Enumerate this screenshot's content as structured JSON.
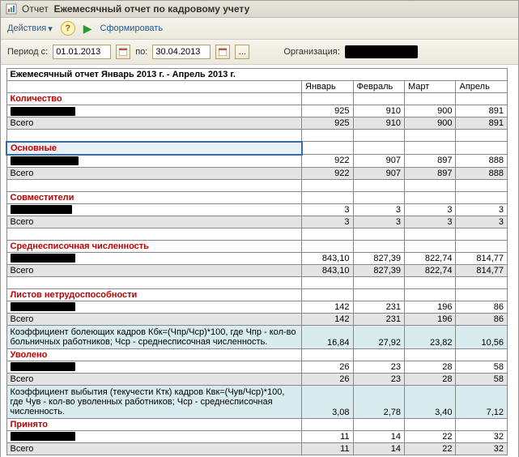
{
  "window": {
    "title_prefix": "Отчет",
    "title_main": "Ежемесячный отчет по кадровому учету"
  },
  "toolbar": {
    "actions": "Действия",
    "form": "Сформировать"
  },
  "period": {
    "label_from": "Период с:",
    "from": "01.01.2013",
    "label_to": "по:",
    "to": "30.04.2013",
    "org_label": "Организация:"
  },
  "report": {
    "title": "Ежемесячный отчет Январь 2013 г. - Апрель 2013 г.",
    "months": [
      "Январь",
      "Февраль",
      "Март",
      "Апрель"
    ],
    "sections": {
      "qty": {
        "label": "Количество",
        "row": [
          925,
          910,
          900,
          891
        ],
        "total_label": "Всего",
        "total": [
          925,
          910,
          900,
          891
        ]
      },
      "main": {
        "label": "Основные",
        "row": [
          922,
          907,
          897,
          888
        ],
        "total_label": "Всего",
        "total": [
          922,
          907,
          897,
          888
        ]
      },
      "part": {
        "label": "Совместители",
        "row": [
          3,
          3,
          3,
          3
        ],
        "total_label": "Всего",
        "total": [
          3,
          3,
          3,
          3
        ]
      },
      "avg": {
        "label": "Среднесписочная численность",
        "row": [
          "843,10",
          "827,39",
          "822,74",
          "814,77"
        ],
        "total_label": "Всего",
        "total": [
          "843,10",
          "827,39",
          "822,74",
          "814,77"
        ]
      },
      "sick": {
        "label": "Листов нетрудоспособности",
        "row": [
          142,
          231,
          196,
          86
        ],
        "total_label": "Всего",
        "total": [
          142,
          231,
          196,
          86
        ],
        "desc": "Коэффициент болеющих кадров Кбк=(Чпр/Чср)*100, где Чпр - кол-во больничных работников; Чср - среднесписочная численность.",
        "coef": [
          "16,84",
          "27,92",
          "23,82",
          "10,56"
        ]
      },
      "fired": {
        "label": "Уволено",
        "row": [
          26,
          23,
          28,
          58
        ],
        "total_label": "Всего",
        "total": [
          26,
          23,
          28,
          58
        ],
        "desc": "Коэффициент выбытия (текучести Ктк) кадров Квк=(Чув/Чср)*100, где Чув - кол-во уволенных работников; Чср - среднесписочная численность.",
        "coef": [
          "3,08",
          "2,78",
          "3,40",
          "7,12"
        ]
      },
      "hired": {
        "label": "Принято",
        "row": [
          11,
          14,
          22,
          32
        ],
        "total_label": "Всего",
        "total": [
          11,
          14,
          22,
          32
        ]
      }
    }
  }
}
